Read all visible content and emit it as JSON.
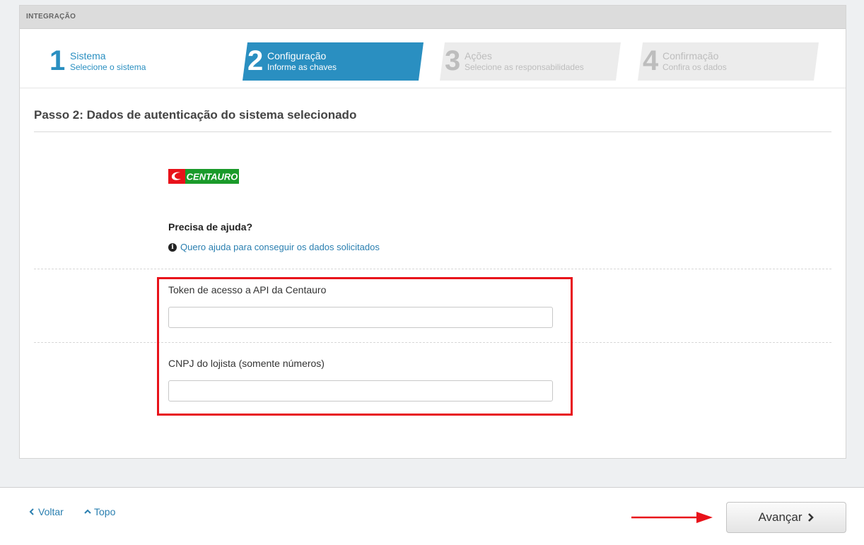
{
  "panel": {
    "header": "INTEGRAÇÃO"
  },
  "steps": [
    {
      "number": "1",
      "title": "Sistema",
      "subtitle": "Selecione o sistema",
      "state": "done"
    },
    {
      "number": "2",
      "title": "Configuração",
      "subtitle": "Informe as chaves",
      "state": "active"
    },
    {
      "number": "3",
      "title": "Ações",
      "subtitle": "Selecione as responsabilidades",
      "state": "pending"
    },
    {
      "number": "4",
      "title": "Confirmação",
      "subtitle": "Confira os dados",
      "state": "pending"
    }
  ],
  "section": {
    "title": "Passo 2: Dados de autenticação do sistema selecionado"
  },
  "logo": {
    "text": "CENTAURO"
  },
  "help": {
    "title": "Precisa de ajuda?",
    "link": "Quero ajuda para conseguir os dados solicitados",
    "icon": "info-icon"
  },
  "form": {
    "token": {
      "label": "Token de acesso a API da Centauro",
      "value": ""
    },
    "cnpj": {
      "label": "CNPJ do lojista (somente números)",
      "value": ""
    }
  },
  "footer": {
    "back_label": "Voltar",
    "top_label": "Topo",
    "next_label": "Avançar"
  },
  "colors": {
    "accent": "#2a8fc1",
    "highlight": "#e8121a",
    "logo_red": "#e8121a",
    "logo_green": "#1a9a2a"
  }
}
